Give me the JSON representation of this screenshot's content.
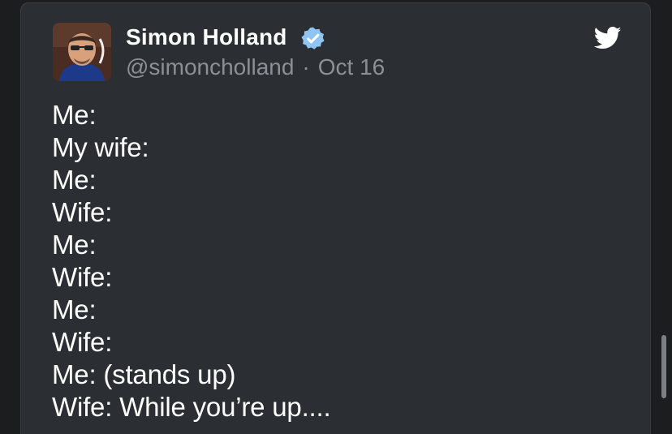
{
  "tweet": {
    "author_name": "Simon Holland",
    "handle": "@simoncholland",
    "separator": "·",
    "date": "Oct 16",
    "verified_icon": "verified-badge-icon",
    "brand_icon": "twitter-bird-icon",
    "lines": [
      "Me:",
      "My wife:",
      "Me:",
      "Wife:",
      "Me:",
      "Wife:",
      "Me:",
      "Wife:",
      "Me: (stands up)",
      "Wife: While you’re up...."
    ]
  },
  "colors": {
    "background": "#1b1d1f",
    "card": "#2b2f33",
    "text": "#ffffff",
    "muted": "#8b9096",
    "verified": "#8ec5f5"
  }
}
